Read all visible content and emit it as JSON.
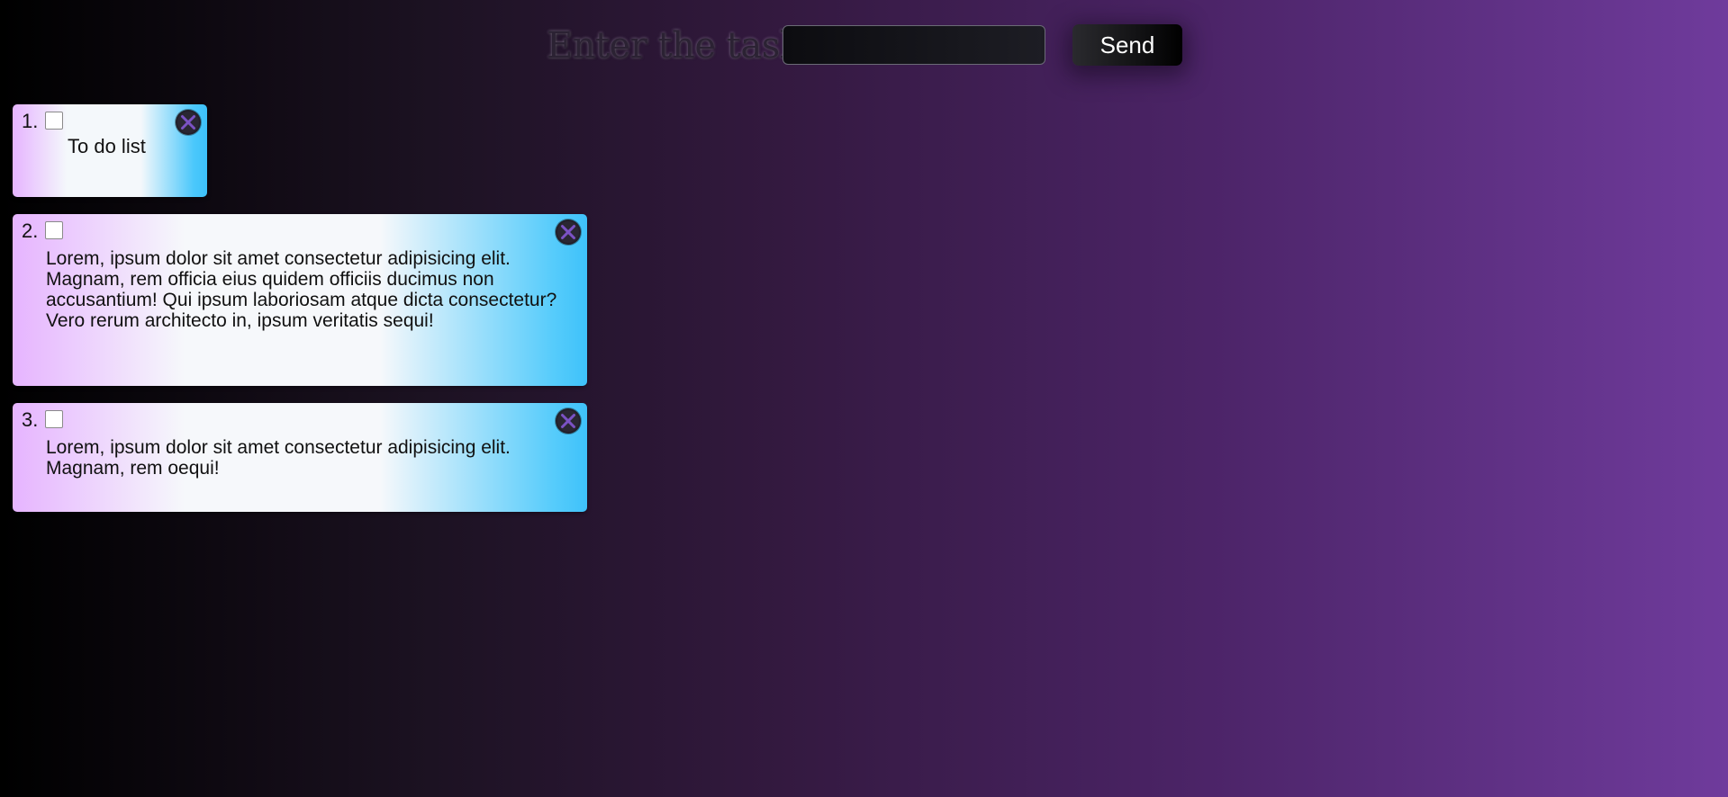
{
  "header": {
    "label": "Enter the task",
    "input_value": "",
    "input_placeholder": "",
    "send_label": "Send"
  },
  "tasks": [
    {
      "number": "1.",
      "text": "To do list",
      "checked": false
    },
    {
      "number": "2.",
      "text": "Lorem, ipsum dolor sit amet consectetur adipisicing elit. Magnam, rem officia eius quidem officiis ducimus non accusantium! Qui ipsum laboriosam atque dicta consectetur? Vero rerum architecto in, ipsum veritatis sequi!",
      "checked": false
    },
    {
      "number": "3.",
      "text": "Lorem, ipsum dolor sit amet consectetur adipisicing elit. Magnam, rem oequi!",
      "checked": false
    }
  ],
  "colors": {
    "background_start": "#000000",
    "background_end": "#6f3b9c",
    "card_left": "#e6b4ff",
    "card_middle": "#f6f8fb",
    "card_right": "#3ec2fa",
    "delete_icon": "#7b52c4"
  },
  "icons": {
    "delete": "close-circle-icon"
  }
}
